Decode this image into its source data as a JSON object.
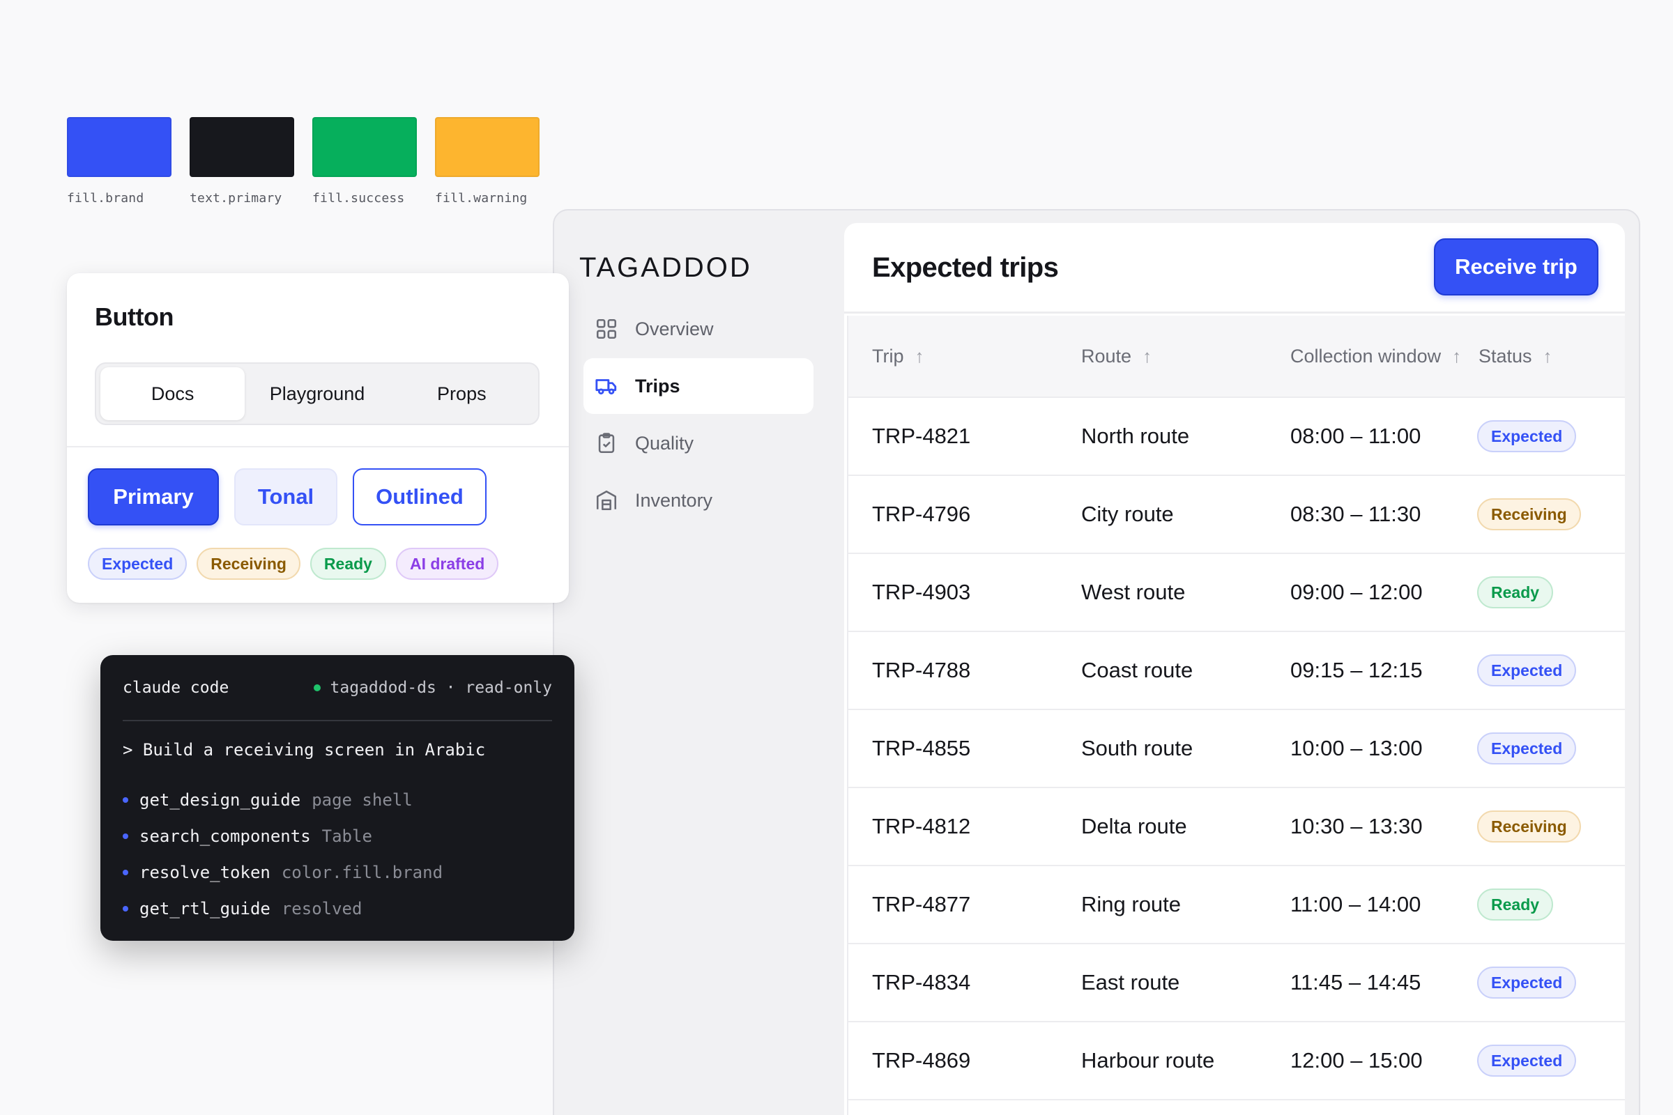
{
  "swatches": [
    {
      "label": "fill.brand",
      "color": "#3451F5"
    },
    {
      "label": "text.primary",
      "color": "#17181D"
    },
    {
      "label": "fill.success",
      "color": "#06AF5C"
    },
    {
      "label": "fill.warning",
      "color": "#FDB52F"
    }
  ],
  "button_card": {
    "title": "Button",
    "tabs": [
      {
        "label": "Docs",
        "active": true
      },
      {
        "label": "Playground",
        "active": false
      },
      {
        "label": "Props",
        "active": false
      }
    ],
    "buttons": {
      "primary": "Primary",
      "tonal": "Tonal",
      "outlined": "Outlined"
    },
    "badges": [
      {
        "label": "Expected",
        "variant": "expected"
      },
      {
        "label": "Receiving",
        "variant": "receiving"
      },
      {
        "label": "Ready",
        "variant": "ready"
      },
      {
        "label": "AI drafted",
        "variant": "ai"
      }
    ]
  },
  "terminal": {
    "title": "claude code",
    "status": "tagaddod-ds · read-only",
    "prompt": "> Build a receiving screen in Arabic",
    "calls": [
      {
        "fn": "get_design_guide",
        "arg": "page shell"
      },
      {
        "fn": "search_components",
        "arg": "Table"
      },
      {
        "fn": "resolve_token",
        "arg": "color.fill.brand"
      },
      {
        "fn": "get_rtl_guide",
        "arg": "resolved"
      }
    ]
  },
  "app": {
    "logo": "TAGADDOD",
    "nav": [
      {
        "label": "Overview",
        "icon": "grid-icon",
        "active": false
      },
      {
        "label": "Trips",
        "icon": "truck-icon",
        "active": true
      },
      {
        "label": "Quality",
        "icon": "clipboard-check-icon",
        "active": false
      },
      {
        "label": "Inventory",
        "icon": "warehouse-icon",
        "active": false
      }
    ],
    "title": "Expected trips",
    "action": "Receive trip",
    "columns": [
      "Trip",
      "Route",
      "Collection window",
      "Status"
    ],
    "sort_glyph": "↑",
    "rows": [
      {
        "trip": "TRP-4821",
        "route": "North route",
        "window": "08:00 – 11:00",
        "status": "Expected"
      },
      {
        "trip": "TRP-4796",
        "route": "City route",
        "window": "08:30 – 11:30",
        "status": "Receiving"
      },
      {
        "trip": "TRP-4903",
        "route": "West route",
        "window": "09:00 – 12:00",
        "status": "Ready"
      },
      {
        "trip": "TRP-4788",
        "route": "Coast route",
        "window": "09:15 – 12:15",
        "status": "Expected"
      },
      {
        "trip": "TRP-4855",
        "route": "South route",
        "window": "10:00 – 13:00",
        "status": "Expected"
      },
      {
        "trip": "TRP-4812",
        "route": "Delta route",
        "window": "10:30 – 13:30",
        "status": "Receiving"
      },
      {
        "trip": "TRP-4877",
        "route": "Ring route",
        "window": "11:00 – 14:00",
        "status": "Ready"
      },
      {
        "trip": "TRP-4834",
        "route": "East route",
        "window": "11:45 – 14:45",
        "status": "Expected"
      },
      {
        "trip": "TRP-4869",
        "route": "Harbour route",
        "window": "12:00 – 15:00",
        "status": "Expected"
      }
    ]
  }
}
